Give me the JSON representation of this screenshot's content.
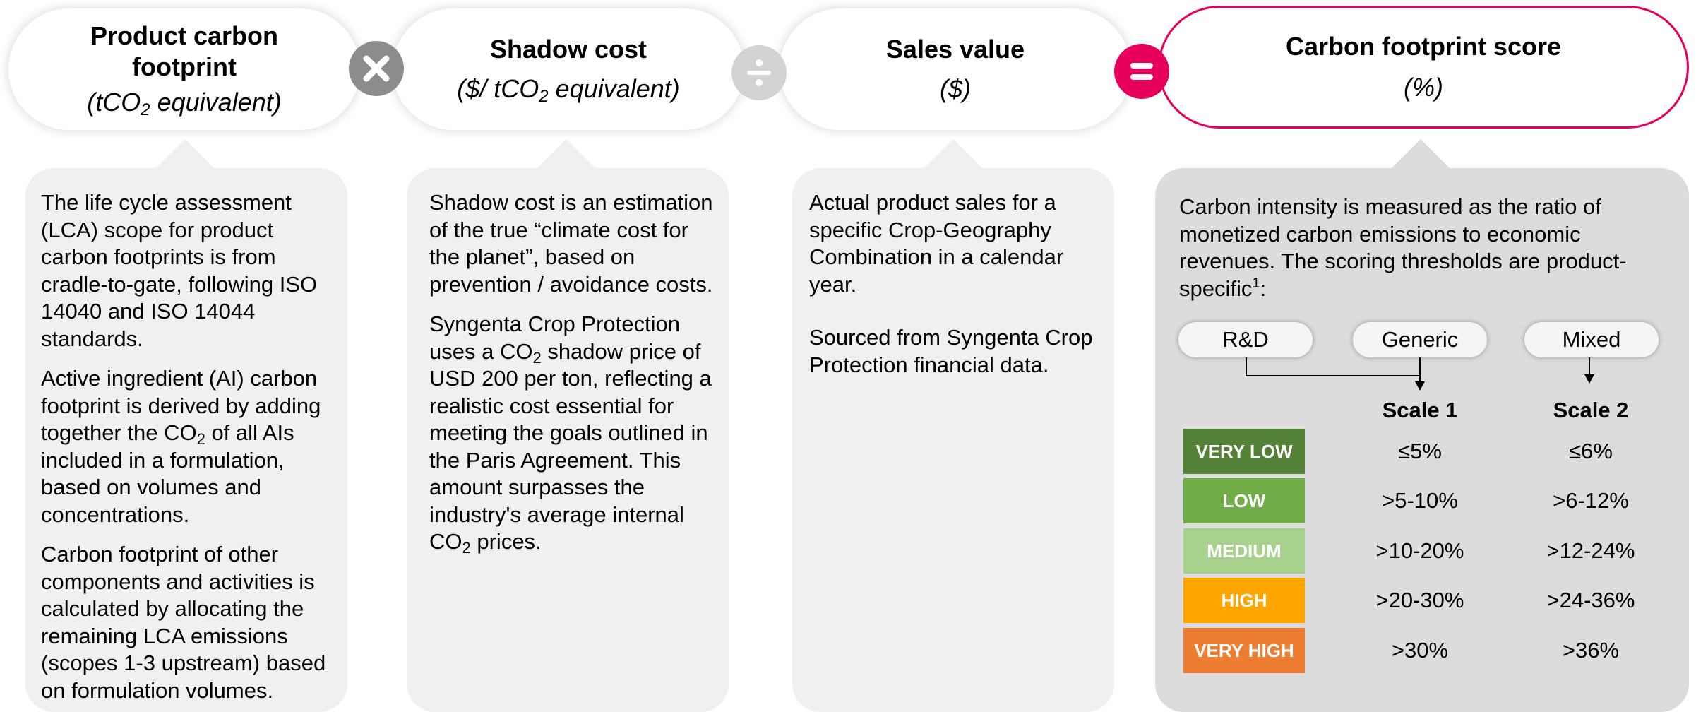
{
  "pills": [
    {
      "title": "Product carbon footprint",
      "unit_pre": "(tCO",
      "unit_sub": "2",
      "unit_post": " equivalent)"
    },
    {
      "title": "Shadow cost",
      "unit_pre": "($/ tCO",
      "unit_sub": "2",
      "unit_post": " equivalent)"
    },
    {
      "title": "Sales value",
      "unit": "($)"
    },
    {
      "title": "Carbon footprint score",
      "unit": "(%)"
    }
  ],
  "operators": {
    "multiply": {
      "icon": "multiply-icon",
      "color": "#8c8c8c"
    },
    "divide": {
      "icon": "divide-icon",
      "color": "#d3d3d3"
    },
    "equals": {
      "icon": "equals-icon",
      "color": "#e6005c"
    }
  },
  "cards": {
    "footprint": {
      "p1": "The life cycle assessment (LCA) scope for product carbon footprints is from cradle-to-gate, following ISO 14040 and ISO 14044 standards.",
      "p2_pre": "Active ingredient (AI) carbon footprint is derived by adding together the CO",
      "p2_sub": "2",
      "p2_post": " of all AIs included in a formulation, based on volumes and concentrations.",
      "p3": "Carbon footprint of other components and activities is calculated by allocating the remaining LCA emissions (scopes 1-3 upstream) based on formulation volumes."
    },
    "shadow": {
      "p1": "Shadow cost is an estimation of the true “climate cost for the planet”, based on prevention / avoidance costs.",
      "p2_pre": "Syngenta Crop Protection uses a CO",
      "p2_sub": "2",
      "p2_mid": " shadow price of USD 200 per ton, reflecting a realistic cost essential for meeting the goals outlined in the Paris Agreement. This amount surpasses the industry's average internal CO",
      "p2_sub2": "2",
      "p2_post": " prices."
    },
    "sales": {
      "p1": "Actual product sales for a specific Crop-Geography Combination in a calendar year.",
      "p2": "Sourced from Syngenta Crop Protection financial data."
    },
    "score": {
      "intro": "Carbon intensity is measured as the ratio of monetized carbon emissions to economic revenues. The scoring thresholds are product-specific",
      "footnote": "1",
      "intro_end": ":",
      "product_types": [
        "R&D",
        "Generic",
        "Mixed"
      ],
      "scale_headers": [
        "Scale 1",
        "Scale 2"
      ],
      "levels": [
        {
          "label": "VERY LOW",
          "color": "#538135",
          "scale1": "≤5%",
          "scale2": "≤6%"
        },
        {
          "label": "LOW",
          "color": "#70ad47",
          "scale1": ">5-10%",
          "scale2": ">6-12%"
        },
        {
          "label": "MEDIUM",
          "color": "#a9d18e",
          "scale1": ">10-20%",
          "scale2": ">12-24%"
        },
        {
          "label": "HIGH",
          "color": "#ffa500",
          "scale1": ">20-30%",
          "scale2": ">24-36%"
        },
        {
          "label": "VERY HIGH",
          "color": "#ed7d31",
          "scale1": ">30%",
          "scale2": ">36%"
        }
      ]
    }
  }
}
